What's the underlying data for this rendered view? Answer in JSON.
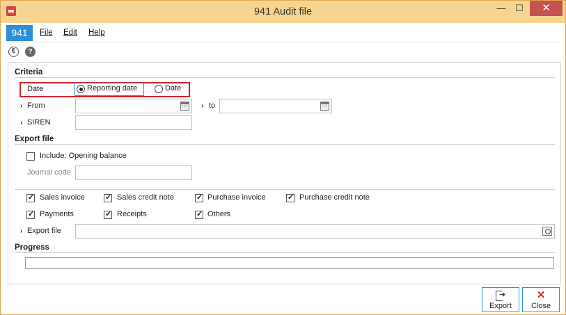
{
  "window": {
    "title": "941 Audit file",
    "minimize": "—",
    "maximize": "☐",
    "close": "✕"
  },
  "menu": {
    "code": "941",
    "file": "File",
    "edit": "Edit",
    "help": "Help"
  },
  "toolbar": {
    "euro_icon": "€",
    "help_icon": "?"
  },
  "criteria": {
    "title": "Criteria",
    "date_label": "Date",
    "radio_reporting": "Reporting date",
    "radio_date": "Date",
    "selected": "Reporting date",
    "from_label": "From",
    "from_value": "",
    "to_label": "to",
    "to_value": "",
    "siren_label": "SIREN",
    "siren_value": ""
  },
  "export": {
    "title": "Export file",
    "include_opening": "Include: Opening balance",
    "include_opening_checked": false,
    "journal_code_label": "Journal code",
    "journal_code_value": "",
    "options": [
      {
        "label": "Sales invoice",
        "checked": true
      },
      {
        "label": "Sales credit note",
        "checked": true
      },
      {
        "label": "Purchase invoice",
        "checked": true
      },
      {
        "label": "Purchase credit note",
        "checked": true
      },
      {
        "label": "Payments",
        "checked": true
      },
      {
        "label": "Receipts",
        "checked": true
      },
      {
        "label": "Others",
        "checked": true
      }
    ],
    "export_file_label": "Export file",
    "export_file_value": ""
  },
  "progress": {
    "title": "Progress",
    "value": 0
  },
  "actions": {
    "export": "Export",
    "close": "Close"
  },
  "colors": {
    "titlebar": "#f7d591",
    "accent": "#2e8fd8",
    "highlight": "#d0262c"
  }
}
